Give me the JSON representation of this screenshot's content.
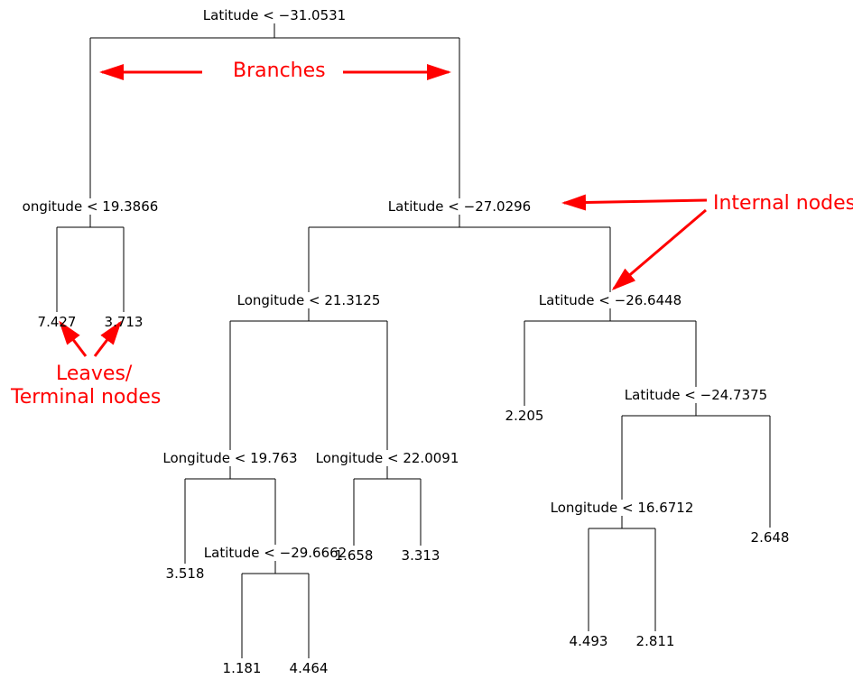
{
  "annotations": {
    "branches": "Branches",
    "internal_nodes": "Internal nodes",
    "leaves_line1": "Leaves/",
    "leaves_line2": "Terminal nodes"
  },
  "nodes": {
    "root": {
      "label": "Latitude < −31.0531"
    },
    "n_long1": {
      "label": "ongitude < 19.3866"
    },
    "n_lat2": {
      "label": "Latitude < −27.0296"
    },
    "n_long21": {
      "label": "Longitude < 21.3125"
    },
    "n_lat26": {
      "label": "Latitude < −26.6448"
    },
    "n_long19": {
      "label": "Longitude < 19.763"
    },
    "n_long22": {
      "label": "Longitude < 22.0091"
    },
    "n_lat24": {
      "label": "Latitude < −24.7375"
    },
    "n_lat29": {
      "label": "Latitude < −29.6662"
    },
    "n_long16": {
      "label": "Longitude < 16.6712"
    }
  },
  "leaves": {
    "l_7427": {
      "value": "7.427"
    },
    "l_3713": {
      "value": "3.713"
    },
    "l_3518": {
      "value": "3.518"
    },
    "l_1181": {
      "value": "1.181"
    },
    "l_4464": {
      "value": "4.464"
    },
    "l_1658": {
      "value": "1.658"
    },
    "l_3313": {
      "value": "3.313"
    },
    "l_2205": {
      "value": "2.205"
    },
    "l_2648": {
      "value": "2.648"
    },
    "l_4493": {
      "value": "4.493"
    },
    "l_2811": {
      "value": "2.811"
    }
  },
  "chart_data": {
    "type": "tree",
    "description": "Decision/regression tree with branches, internal nodes, and terminal leaf values",
    "tree": {
      "split": "Latitude < -31.0531",
      "left": {
        "split": "Longitude < 19.3866",
        "left": {
          "value": 7.427
        },
        "right": {
          "value": 3.713
        }
      },
      "right": {
        "split": "Latitude < -27.0296",
        "left": {
          "split": "Longitude < 21.3125",
          "left": {
            "split": "Longitude < 19.763",
            "left": {
              "value": 3.518
            },
            "right": {
              "split": "Latitude < -29.6662",
              "left": {
                "value": 1.181
              },
              "right": {
                "value": 4.464
              }
            }
          },
          "right": {
            "split": "Longitude < 22.0091",
            "left": {
              "value": 1.658
            },
            "right": {
              "value": 3.313
            }
          }
        },
        "right": {
          "split": "Latitude < -26.6448",
          "left": {
            "value": 2.205
          },
          "right": {
            "split": "Latitude < -24.7375",
            "left": {
              "split": "Longitude < 16.6712",
              "left": {
                "value": 4.493
              },
              "right": {
                "value": 2.811
              }
            },
            "right": {
              "value": 2.648
            }
          }
        }
      }
    }
  }
}
